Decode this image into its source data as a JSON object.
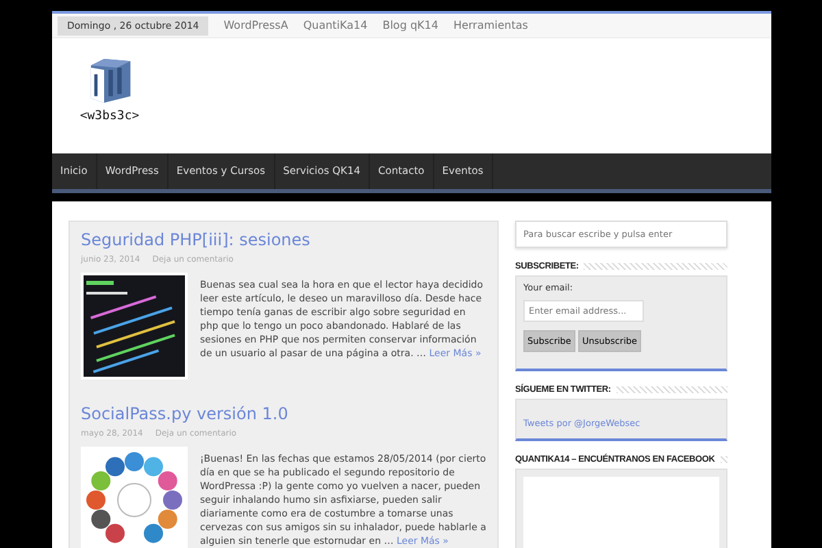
{
  "top_bar": {
    "date": "Domingo , 26 octubre 2014",
    "links": [
      "WordPressA",
      "QuantiKa14",
      "Blog qK14",
      "Herramientas"
    ]
  },
  "logo": {
    "text": "<w3bs3c>"
  },
  "nav": {
    "items": [
      "Inicio",
      "WordPress",
      "Eventos y Cursos",
      "Servicios QK14",
      "Contacto",
      "Eventos"
    ]
  },
  "posts": [
    {
      "title": "Seguridad PHP[iii]: sesiones",
      "date": "junio 23, 2014",
      "comments": "Deja un comentario",
      "kind": "code",
      "excerpt": "Buenas sea cual sea la hora en que el lector haya decidido leer este artículo, le deseo un maravilloso día. Desde hace tiempo tenía ganas de escribir algo sobre seguridad en php que lo tengo un poco abandonado. Hablaré de las sesiones en PHP que nos permiten conservar información de un usuario al pasar de una página a otra. …",
      "more": "Leer Más »"
    },
    {
      "title": "SocialPass.py versión 1.0",
      "date": "mayo 28, 2014",
      "comments": "Deja un comentario",
      "kind": "social",
      "excerpt": "¡Buenas! En las fechas que estamos 28/05/2014 (por cierto día en que se ha publicado el segundo repositorio de WordPressa :P) la gente como yo vuelven a nacer, pueden seguir inhalando humo sin asfixiarse, pueden salir diariamente como era de costumbre a tomarse unas cervezas con sus amigos sin su inhalador, puede hablarle a alguien sin tenerle que estornudar en …",
      "more": "Leer Más »"
    }
  ],
  "sidebar": {
    "search": {
      "placeholder": "Para buscar escribe y pulsa enter"
    },
    "subscribe": {
      "heading": "SUBSCRIBETE:",
      "label": "Your email:",
      "placeholder": "Enter email address...",
      "buttons": [
        "Subscribe",
        "Unsubscribe"
      ]
    },
    "twitter": {
      "heading": "SÍGUEME EN TWITTER:",
      "link": "Tweets por @JorgeWebsec"
    },
    "facebook": {
      "heading": "QUANTIKA14 – ENCUÉNTRANOS EN FACEBOOK"
    }
  }
}
